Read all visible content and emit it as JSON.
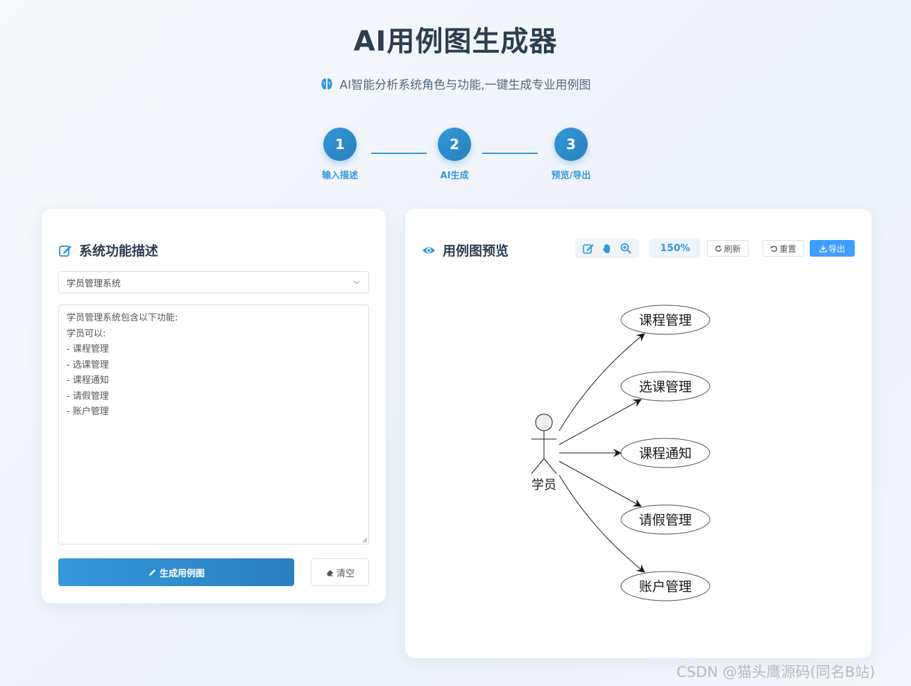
{
  "header": {
    "title": "AI用例图生成器",
    "subtitle": "AI智能分析系统角色与功能,一键生成专业用例图"
  },
  "steps": [
    {
      "number": "1",
      "label": "输入描述"
    },
    {
      "number": "2",
      "label": "AI生成"
    },
    {
      "number": "3",
      "label": "预览/导出"
    }
  ],
  "left_panel": {
    "title": "系统功能描述",
    "system_select": "学员管理系统",
    "description": "学员管理系统包含以下功能:\n学员可以:\n- 课程管理\n- 选课管理\n- 课程通知\n- 请假管理\n- 账户管理",
    "generate_label": "生成用例图",
    "clear_label": "清空"
  },
  "right_panel": {
    "title": "用例图预览",
    "zoom": "150%",
    "refresh_label": "刷新",
    "reset_label": "重置",
    "export_label": "导出"
  },
  "diagram": {
    "actor": "学员",
    "use_cases": [
      "课程管理",
      "选课管理",
      "课程通知",
      "请假管理",
      "账户管理"
    ]
  },
  "colors": {
    "primary": "#3498db",
    "export_button": "#409eff",
    "title": "#2c3e50"
  },
  "watermark": "CSDN @猫头鹰源码(同名B站)"
}
